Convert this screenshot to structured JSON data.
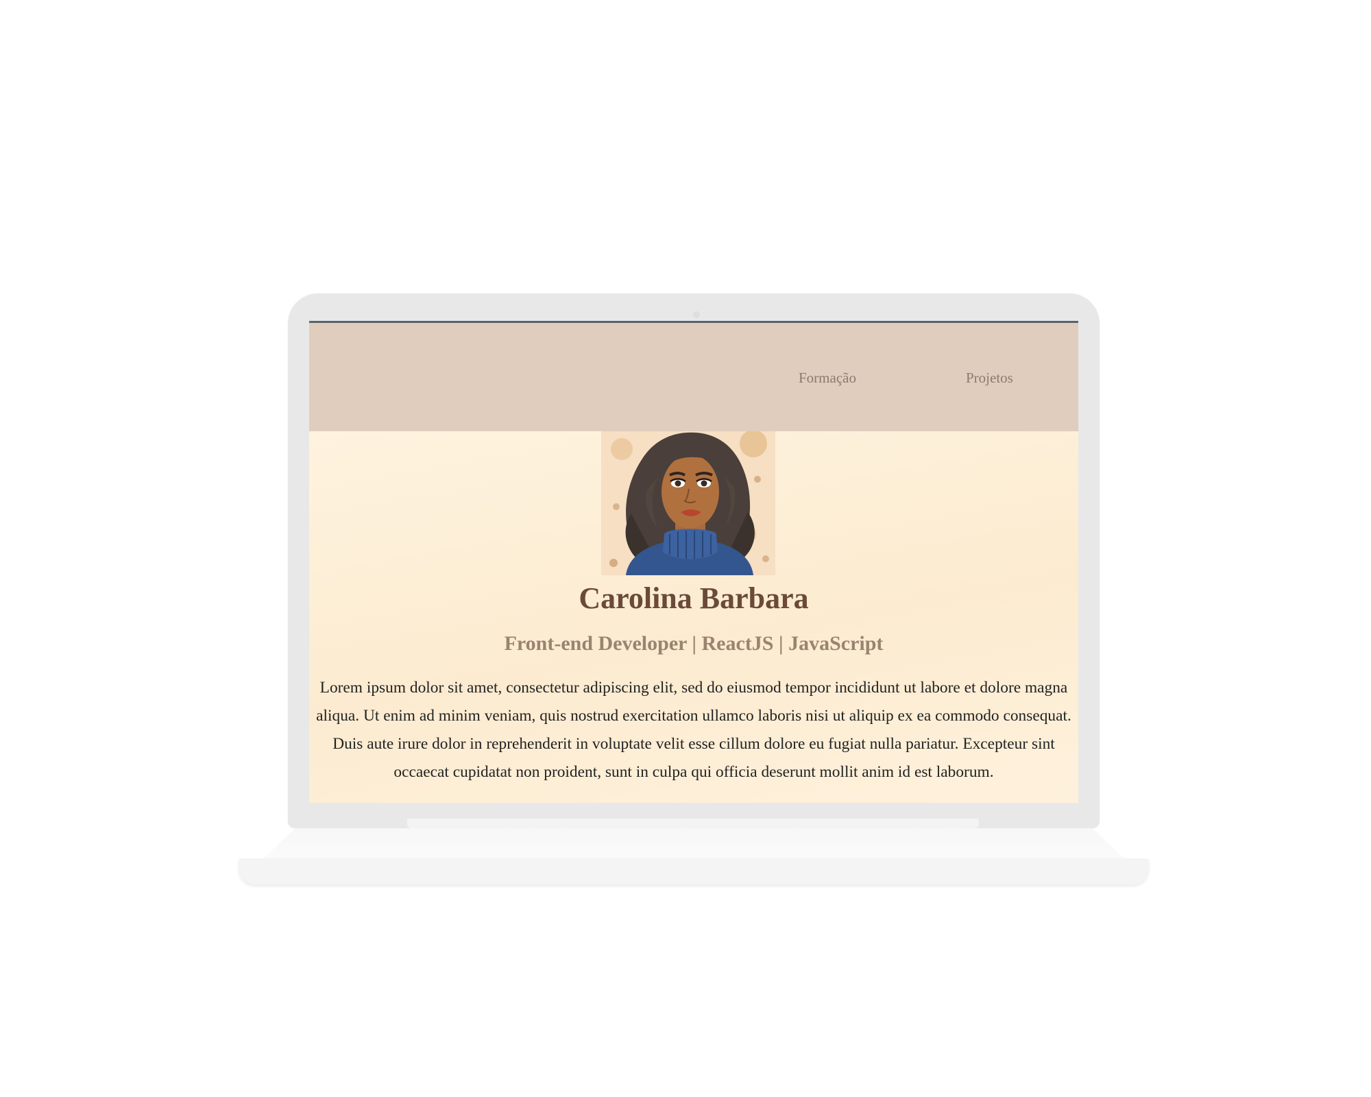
{
  "nav": {
    "links": [
      {
        "label": "Formação"
      },
      {
        "label": "Projetos"
      }
    ]
  },
  "profile": {
    "name": "Carolina Barbara",
    "subtitle": "Front-end Developer | ReactJS | JavaScript",
    "bio_lines": [
      "Lorem ipsum dolor sit amet, consectetur adipiscing elit, sed do eiusmod tempor incididunt ut labore et dolore magna",
      "aliqua. Ut enim ad minim veniam, quis nostrud exercitation ullamco laboris nisi ut aliquip ex ea commodo consequat.",
      "Duis aute irure dolor in reprehenderit in voluptate velit esse cillum dolore eu fugiat nulla pariatur. Excepteur sint",
      "occaecat cupidatat non proident, sunt in culpa qui officia deserunt mollit anim id est laborum."
    ]
  },
  "colors": {
    "navbar_bg": "#e1cdbd",
    "page_bg": "#fdefd6",
    "name": "#6b4a3a",
    "subtitle": "#9a8370",
    "nav_link": "#8a7a70"
  },
  "icons": {
    "avatar": "woman-portrait-illustration"
  }
}
